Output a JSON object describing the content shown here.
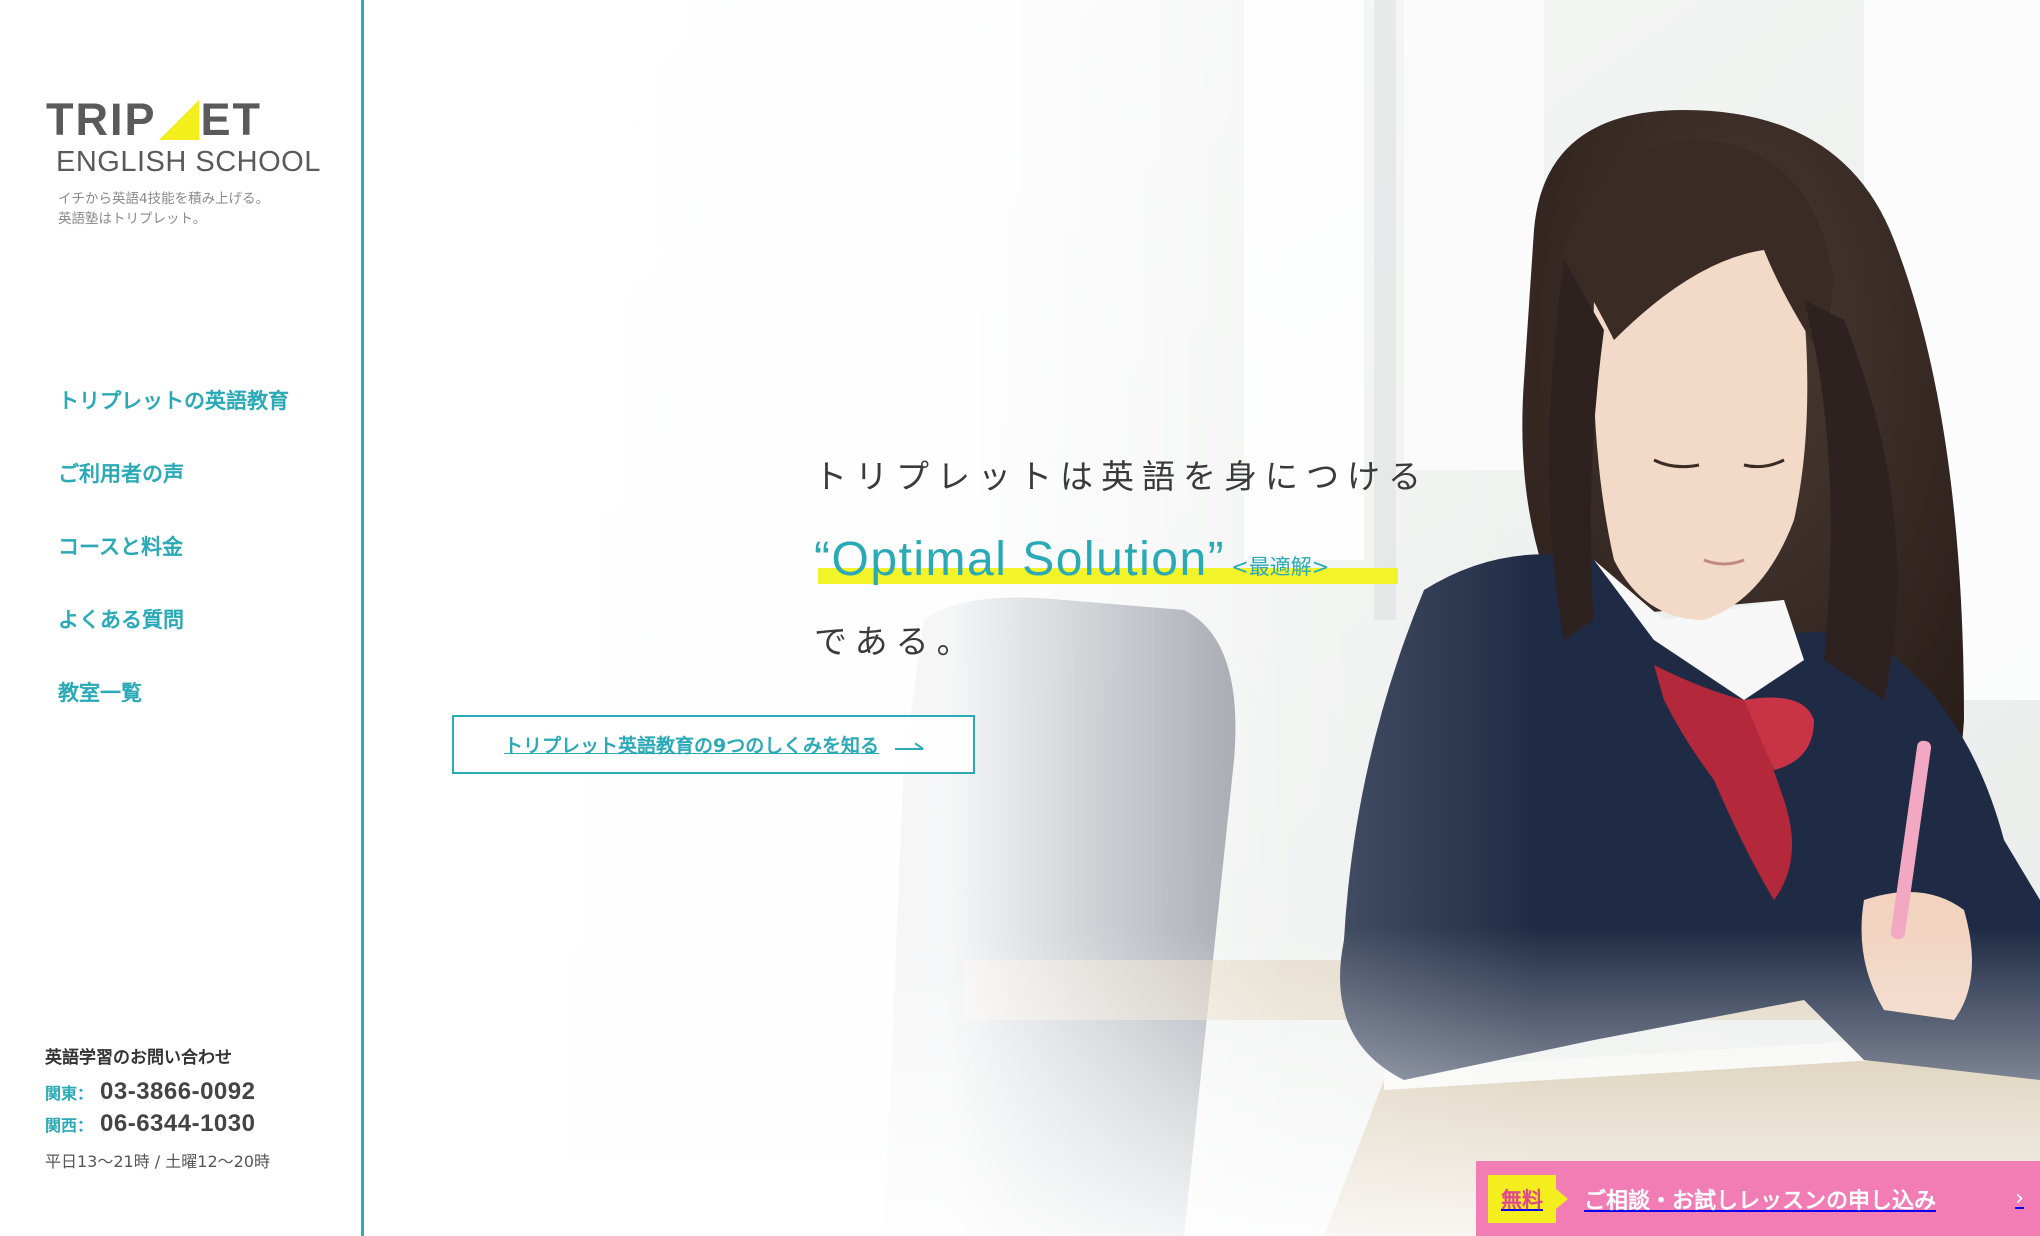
{
  "brand": {
    "logo_word_left": "TRIP",
    "logo_word_right": "ET",
    "logo_subtitle": "ENGLISH SCHOOL",
    "tagline_line1": "イチから英語4技能を積み上げる。",
    "tagline_line2": "英語塾はトリプレット。",
    "accent_color": "#2aa9b6",
    "highlight_color": "#f3f32a"
  },
  "nav": {
    "items": [
      {
        "label": "トリプレットの英語教育"
      },
      {
        "label": "ご利用者の声"
      },
      {
        "label": "コースと料金"
      },
      {
        "label": "よくある質問"
      },
      {
        "label": "教室一覧"
      }
    ]
  },
  "contact": {
    "title": "英語学習のお問い合わせ",
    "kanto_label": "関東：",
    "kanto_phone": "03-3866-0092",
    "kansai_label": "関西：",
    "kansai_phone": "06-6344-1030",
    "hours": "平日13〜21時 / 土曜12〜20時"
  },
  "hero": {
    "line1": "トリプレットは英語を身につける",
    "line2_emphasis": "“Optimal Solution”",
    "line2_note": "<最適解>",
    "line3": "である。",
    "cta_label": "トリプレット英語教育の9つのしくみを知る"
  },
  "floating_cta": {
    "badge": "無料",
    "label": "ご相談・お試しレッスンの申し込み",
    "chevron": "›",
    "color": "#f27cb4"
  }
}
